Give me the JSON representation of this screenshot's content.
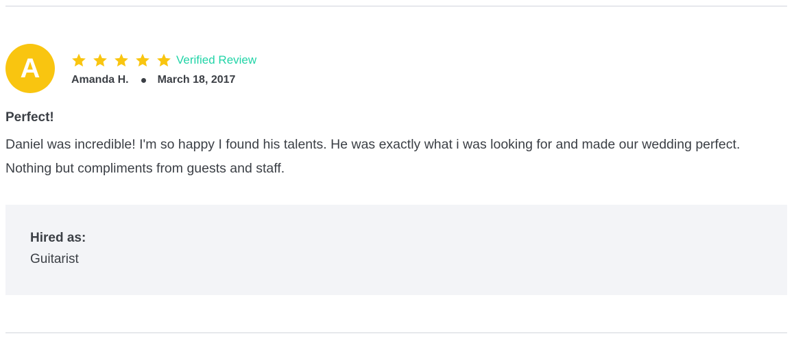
{
  "review": {
    "avatar_initial": "A",
    "rating": 5,
    "rating_max": 5,
    "verified_label": "Verified Review",
    "author": "Amanda H.",
    "date": "March 18, 2017",
    "title": "Perfect!",
    "body": "Daniel was incredible! I'm so happy I found his talents. He was exactly what i was looking for and made our wedding perfect. Nothing but compliments from guests and staff."
  },
  "hired": {
    "label": "Hired as:",
    "value": "Guitarist"
  },
  "colors": {
    "avatar_bg": "#f9c510",
    "star": "#f9c510",
    "verified": "#21d4a7",
    "text": "#3b3f45",
    "panel_bg": "#f3f4f7",
    "divider": "#e6e8ec"
  },
  "icons": {
    "star": "star-icon",
    "separator": "bullet-dot-icon"
  }
}
